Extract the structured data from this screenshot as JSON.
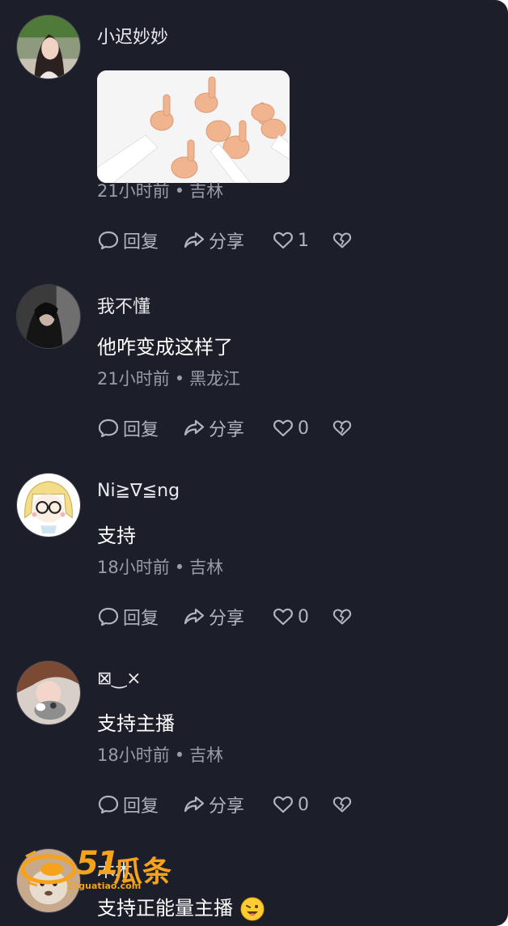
{
  "comments": [
    {
      "username": "小迟妙妙",
      "content": "",
      "has_image": true,
      "time": "21小时前",
      "location": "吉林",
      "likes": "1"
    },
    {
      "username": "我不懂",
      "content": "他咋变成这样了",
      "time": "21小时前",
      "location": "黑龙江",
      "likes": "0"
    },
    {
      "username": "Ni≧∇≦ng",
      "content": "支持",
      "time": "18小时前",
      "location": "吉林",
      "likes": "0"
    },
    {
      "username": "⊠‿×",
      "content": "支持主播",
      "time": "18小时前",
      "location": "吉林",
      "likes": "0"
    },
    {
      "username": "木木",
      "content": "支持正能量主播",
      "has_emoji": true
    }
  ],
  "actions": {
    "reply": "回复",
    "share": "分享"
  },
  "meta_separator": "•",
  "watermark": {
    "number": "51",
    "name": "瓜条",
    "url": "51guatiao.com"
  },
  "colors": {
    "background": "#1c1e29",
    "text": "#ffffff",
    "secondary": "#9a9ca6",
    "action": "#b3b5bd",
    "watermark": "#f7a21b"
  },
  "icons": [
    "reply-icon",
    "share-icon",
    "heart-icon",
    "broken-heart-icon",
    "smile-emoji"
  ]
}
